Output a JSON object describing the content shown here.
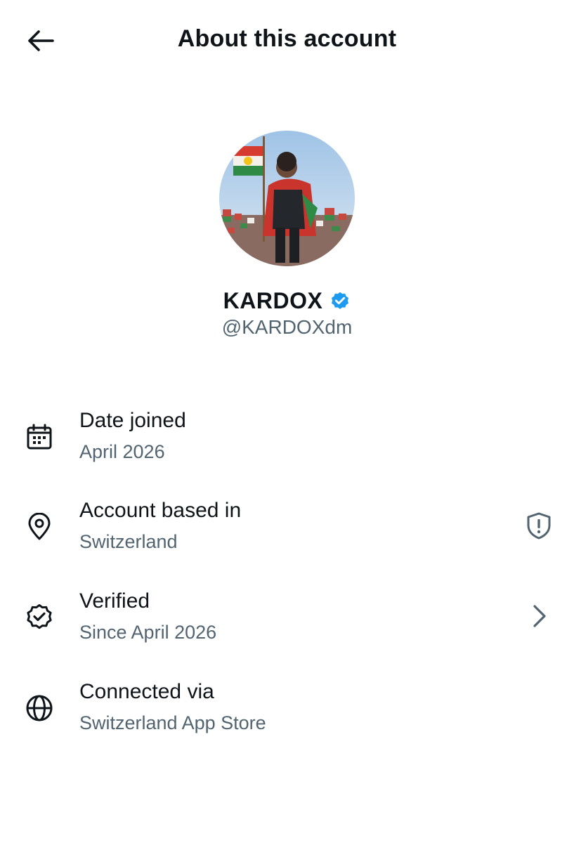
{
  "header": {
    "title": "About this account",
    "back_icon": "arrow-left-icon"
  },
  "profile": {
    "display_name": "KARDOX",
    "handle": "@KARDOXdm",
    "verified": true,
    "badge_color": "#1d9bf0",
    "avatar_description_icon": "avatar-photo"
  },
  "details": [
    {
      "icon": "calendar-icon",
      "label": "Date joined",
      "value": "April 2026"
    },
    {
      "icon": "location-pin-icon",
      "label": "Account based in",
      "value": "Switzerland",
      "trailing_icon": "shield-alert-icon"
    },
    {
      "icon": "verified-badge-outline-icon",
      "label": "Verified",
      "value": "Since April 2026",
      "trailing_icon": "chevron-right-icon"
    },
    {
      "icon": "globe-icon",
      "label": "Connected via",
      "value": "Switzerland App Store"
    }
  ],
  "colors": {
    "text_primary": "#0f1419",
    "text_secondary": "#536471",
    "accent": "#1d9bf0"
  }
}
